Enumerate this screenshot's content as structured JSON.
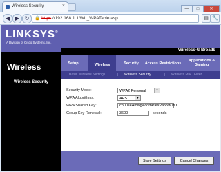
{
  "browser": {
    "tab_title": "Wireless Security",
    "tab_close": "×",
    "url": "https://192.168.1.1/WL_WPATable.asp",
    "url_scheme": "https",
    "url_rest": "://192.168.1.1/WL_WPATable.asp",
    "icons": {
      "back": "◀",
      "forward": "▶",
      "reload": "↻",
      "lock": "🔒",
      "page": "▤",
      "tools": "🔧"
    }
  },
  "window_controls": {
    "minimize": "—",
    "maximize": "□",
    "close": "✕"
  },
  "brand": {
    "logo": "LINKSYS",
    "registered": "®",
    "tagline": "A Division of Cisco Systems, Inc.",
    "product": "Wireless-G Broadb"
  },
  "section_title": "Wireless",
  "nav": {
    "items": [
      {
        "label": "Setup"
      },
      {
        "label": "Wireless",
        "active": true
      },
      {
        "label": "Security"
      },
      {
        "label": "Access Restrictions"
      },
      {
        "label": "Applications & Gaming"
      }
    ]
  },
  "subnav": {
    "items": [
      {
        "label": "Basic Wireless Settings"
      },
      {
        "label": "Wireless Security",
        "selected": true
      },
      {
        "label": "Wireless MAC Filter"
      }
    ],
    "separator": "|"
  },
  "left_panel_title": "Wireless Security",
  "form": {
    "security_mode_label": "Security Mode:",
    "security_mode_value": "WPA2 Personal",
    "wpa_algorithms_label": "WPA Algorithms:",
    "wpa_algorithms_value": "AES",
    "wpa_shared_key_label": "WPA Shared Key:",
    "wpa_shared_key_value": "ch00seAloNg&comPlexPa55w0rD",
    "group_key_renewal_label": "Group Key Renewal:",
    "group_key_renewal_value": "3600",
    "group_key_renewal_unit": "seconds"
  },
  "buttons": {
    "save": "Save Settings",
    "cancel": "Cancel Changes"
  },
  "colors": {
    "header_purple": "#5f5fb0",
    "nav_dark": "#3e3e8f",
    "black": "#000000"
  }
}
